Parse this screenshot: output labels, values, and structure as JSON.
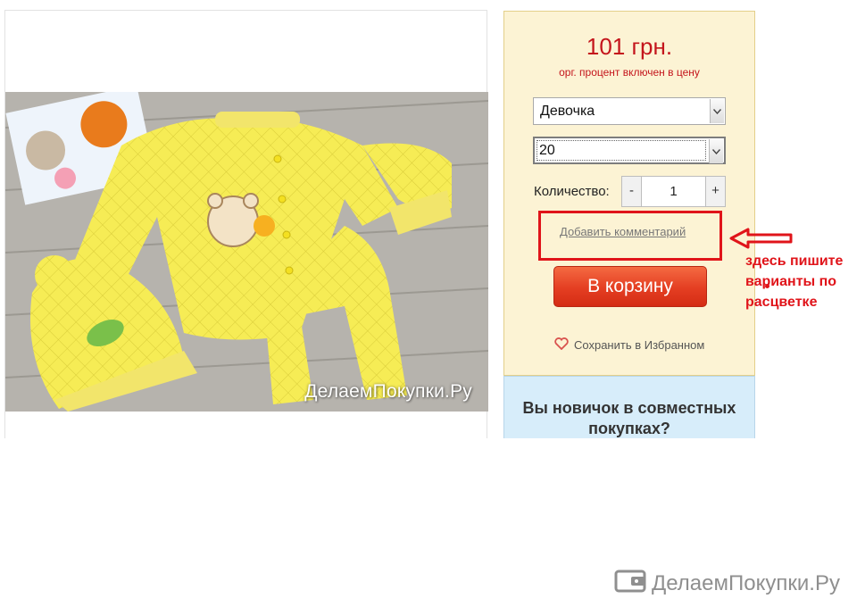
{
  "product": {
    "image_alt": "Жёлтый комплект для новорождённых",
    "photo_watermark": "ДелаемПокупки.Ру"
  },
  "order": {
    "price": "101 грн.",
    "price_note": "орг. процент включен в цену",
    "gender_select": {
      "selected": "Девочка"
    },
    "size_select": {
      "selected": "20"
    },
    "quantity_label": "Количество:",
    "quantity_minus": "-",
    "quantity_value": "1",
    "quantity_plus": "+",
    "add_comment_link": "Добавить комментарий",
    "cart_button": "В корзину",
    "save_favorites": "Сохранить в Избранном"
  },
  "newcomer": {
    "title": "Вы новичок в совместных покупках?"
  },
  "annotation": {
    "text": "здесь пишите варианты по расцветке"
  },
  "footer": {
    "watermark": "ДелаемПокупки.Ру"
  },
  "colors": {
    "price_red": "#c4151c",
    "annotation_red": "#e0141a",
    "cart_button": "#e43e22",
    "panel_bg": "#fcf3d4",
    "newcomer_bg": "#d7edfa"
  }
}
